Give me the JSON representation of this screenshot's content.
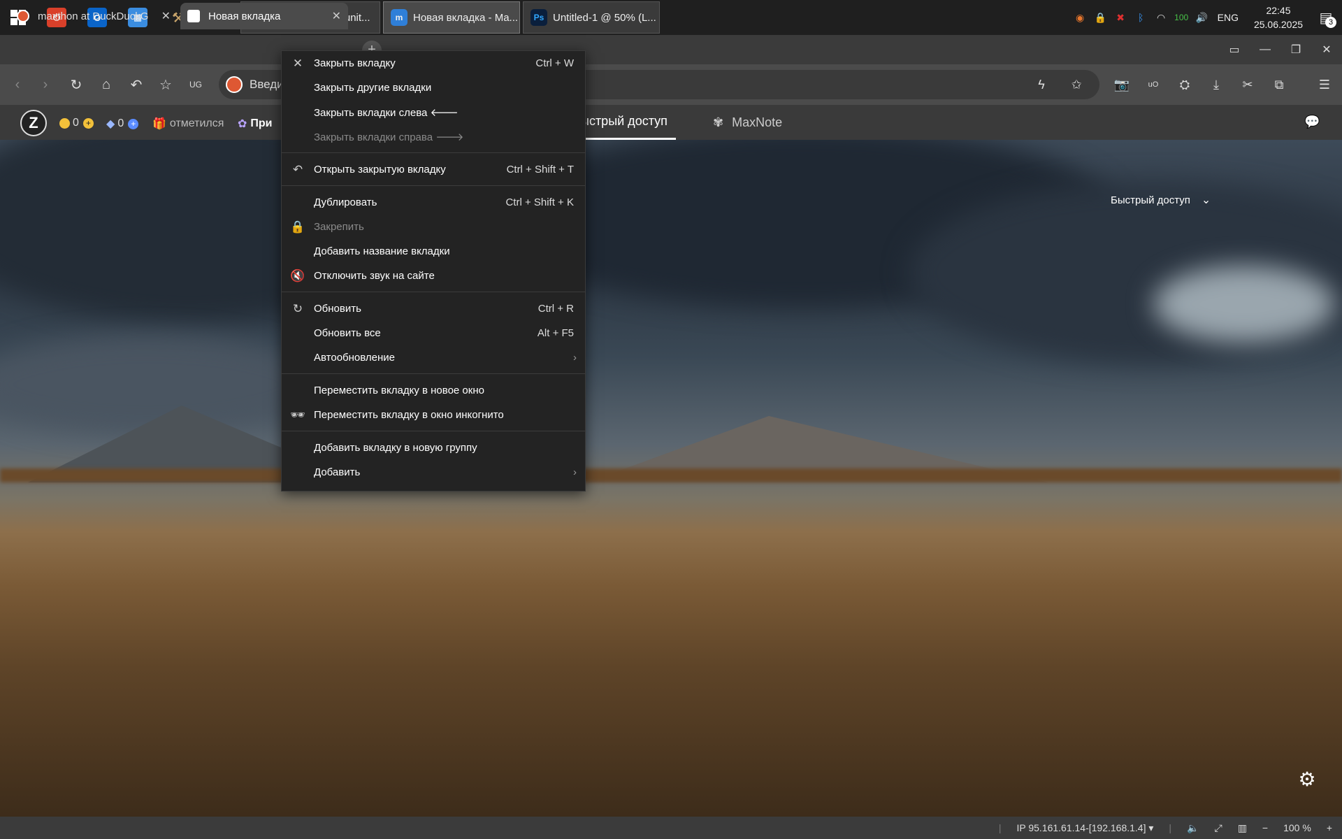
{
  "taskbar": {
    "apps": [
      {
        "label": "Maxthon Communit...",
        "color": "#2f5fd0"
      },
      {
        "label": "Новая вкладка - Ma...",
        "color": "#2f7fd8"
      },
      {
        "label": "Untitled-1 @ 50% (L...",
        "color": "#0a1f3c",
        "icon_text": "Ps"
      }
    ],
    "tray_battery": "100",
    "lang": "ENG",
    "time": "22:45",
    "date": "25.06.2025",
    "notifications": "3"
  },
  "tabs": [
    {
      "label": "maxthon at DuckDuckG",
      "favicon": "#de5833"
    },
    {
      "label": "Новая вкладка",
      "favicon": "#ffffff"
    }
  ],
  "urlbar": {
    "placeholder": "Введи"
  },
  "bookmarks": {
    "avatar": "Z",
    "coins": "0",
    "gems": "0",
    "checkin": "отметился",
    "apps": "При"
  },
  "nav": {
    "quick_access": "ыстрый доступ",
    "maxnote": "MaxNote"
  },
  "quickaccess_dropdown": "Быстрый доступ",
  "statusbar": {
    "ip": "IP 95.161.61.14-[192.168.1.4]",
    "zoom": "100 %"
  },
  "context_menu": {
    "groups": [
      [
        {
          "icon": "✕",
          "icon_name": "close-icon",
          "label": "Закрыть вкладку",
          "shortcut": "Ctrl + W"
        },
        {
          "label": "Закрыть другие вкладки"
        },
        {
          "label": "Закрыть вкладки слева 🡐"
        },
        {
          "label": "Закрыть вкладки справа 🡒",
          "disabled": true
        }
      ],
      [
        {
          "icon": "↶",
          "icon_name": "undo-icon",
          "label": "Открыть закрытую вкладку",
          "shortcut": "Ctrl + Shift + T"
        }
      ],
      [
        {
          "label": "Дублировать",
          "shortcut": "Ctrl + Shift + K"
        },
        {
          "icon": "🔒",
          "icon_name": "lock-icon",
          "label": "Закрепить",
          "disabled": true
        },
        {
          "label": "Добавить название вкладки"
        },
        {
          "icon": "🔇",
          "icon_name": "mute-icon",
          "label": "Отключить звук на сайте"
        }
      ],
      [
        {
          "icon": "↻",
          "icon_name": "reload-icon",
          "label": "Обновить",
          "shortcut": "Ctrl + R"
        },
        {
          "label": "Обновить все",
          "shortcut": "Alt + F5"
        },
        {
          "label": "Автообновление",
          "submenu": true
        }
      ],
      [
        {
          "label": "Переместить вкладку в новое окно"
        },
        {
          "icon": "🕶",
          "icon_name": "incognito-icon",
          "label": "Переместить вкладку в окно инкогнито"
        }
      ],
      [
        {
          "label": "Добавить вкладку в новую группу"
        },
        {
          "label": "Добавить",
          "submenu": true
        }
      ]
    ]
  }
}
